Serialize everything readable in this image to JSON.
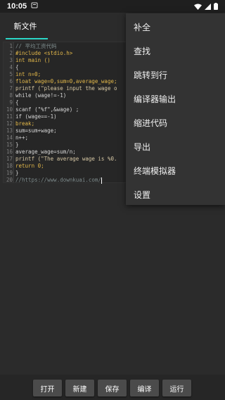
{
  "status_bar": {
    "time": "10:05",
    "extra_icon": "app-notification-icon",
    "icons": [
      "wifi-icon",
      "signal-icon",
      "battery-icon"
    ]
  },
  "tab": {
    "label": "新文件"
  },
  "editor": {
    "lines": [
      {
        "n": "1",
        "text": "// 平均工资代码",
        "kind": "comment"
      },
      {
        "n": "2",
        "text": "#include <stdio.h>",
        "kind": "keyword"
      },
      {
        "n": "3",
        "text": "int main ()",
        "kind": "keyword"
      },
      {
        "n": "4",
        "text": "{",
        "kind": "plain"
      },
      {
        "n": "5",
        "text": "int n=0;",
        "kind": "keyword"
      },
      {
        "n": "6",
        "text": "float wage=0,sum=0,average_wage;",
        "kind": "keyword"
      },
      {
        "n": "7",
        "text": "printf (\"please input the wage o",
        "kind": "string"
      },
      {
        "n": "8",
        "text": "while (wage!=-1)",
        "kind": "plain"
      },
      {
        "n": "9",
        "text": "{",
        "kind": "plain"
      },
      {
        "n": "10",
        "text": "scanf (\"%f\",&wage) ;",
        "kind": "plain"
      },
      {
        "n": "11",
        "text": "if (wage==-1)",
        "kind": "plain"
      },
      {
        "n": "12",
        "text": "break;",
        "kind": "keyword"
      },
      {
        "n": "13",
        "text": "sum=sum+wage;",
        "kind": "plain"
      },
      {
        "n": "14",
        "text": "n++;",
        "kind": "plain"
      },
      {
        "n": "15",
        "text": "}",
        "kind": "plain"
      },
      {
        "n": "16",
        "text": "average_wage=sum/n;",
        "kind": "plain"
      },
      {
        "n": "17",
        "text": "printf (\"The average wage is %0.",
        "kind": "string"
      },
      {
        "n": "18",
        "text": "return 0;",
        "kind": "keyword"
      },
      {
        "n": "19",
        "text": "}",
        "kind": "plain"
      },
      {
        "n": "20",
        "text": "//https://www.downkuai.com/",
        "kind": "comment"
      }
    ]
  },
  "menu": {
    "items": [
      "补全",
      "查找",
      "跳转到行",
      "编译器输出",
      "缩进代码",
      "导出",
      "终端模拟器",
      "设置"
    ]
  },
  "toolbar": {
    "open_label": "打开",
    "new_label": "新建",
    "save_label": "保存",
    "compile_label": "编译",
    "run_label": "运行"
  },
  "colors": {
    "accent": "#2bd6c6",
    "background": "#2b2b2b",
    "menu_background": "#333333"
  }
}
